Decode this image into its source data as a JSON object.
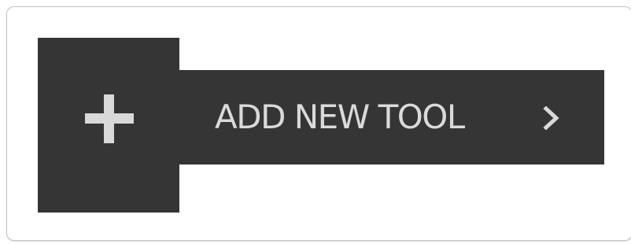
{
  "add_tool_button": {
    "label": "ADD NEW TOOL",
    "leading_icon": "plus-icon",
    "trailing_icon": "chevron-right-icon"
  },
  "colors": {
    "button_background": "#353535",
    "button_text": "#dadada",
    "card_border": "#c4c4c4",
    "page_background": "#ffffff"
  }
}
